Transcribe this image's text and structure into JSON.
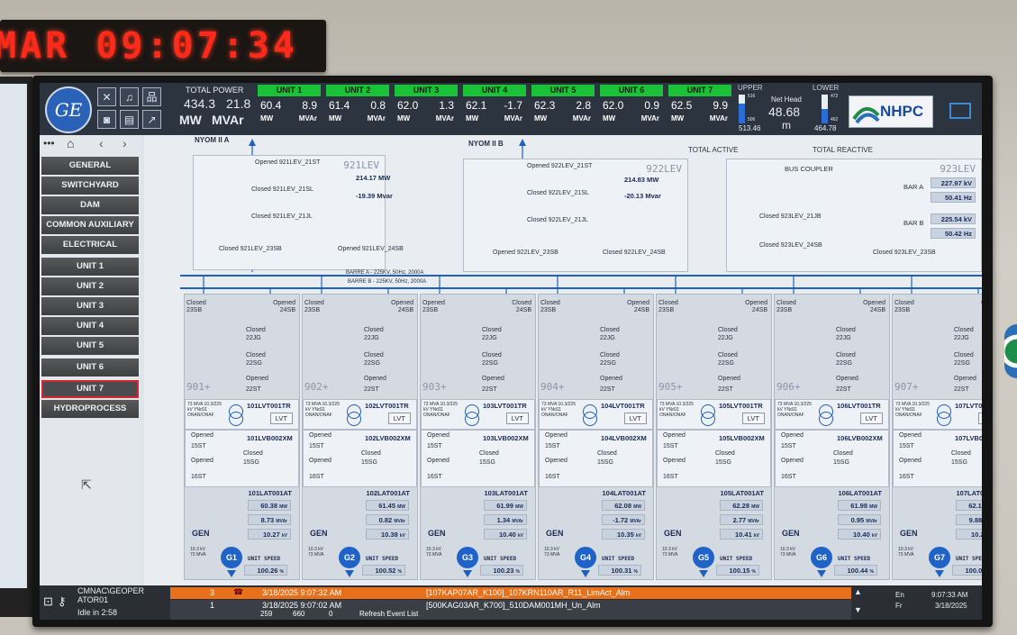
{
  "clock": {
    "text": "MAR 09:07:34"
  },
  "topbar": {
    "total_power_label": "TOTAL POWER",
    "total_mw": "434.3",
    "total_mvar": "21.8",
    "mw_label": "MW",
    "mvar_label": "MVAr",
    "units": [
      {
        "name": "UNIT 1",
        "mw": "60.4",
        "mvar": "8.9"
      },
      {
        "name": "UNIT 2",
        "mw": "61.4",
        "mvar": "0.8"
      },
      {
        "name": "UNIT 3",
        "mw": "62.0",
        "mvar": "1.3"
      },
      {
        "name": "UNIT 4",
        "mw": "62.1",
        "mvar": "-1.7"
      },
      {
        "name": "UNIT 5",
        "mw": "62.3",
        "mvar": "2.8"
      },
      {
        "name": "UNIT 6",
        "mw": "62.0",
        "mvar": "0.9"
      },
      {
        "name": "UNIT 7",
        "mw": "62.5",
        "mvar": "9.9"
      }
    ],
    "upper_label": "UPPER",
    "lower_label": "LOWER",
    "upper_level": "513.46",
    "lower_level": "464.78",
    "upper_ticks": [
      "516",
      "506"
    ],
    "lower_ticks": [
      "472",
      "462"
    ],
    "net_head_label": "Net Head",
    "net_head_value": "48.68",
    "net_head_unit": "m",
    "logo_text": "NHPC"
  },
  "sidebar": {
    "items": [
      "GENERAL",
      "SWITCHYARD",
      "DAM",
      "COMMON AUXILIARY",
      "ELECTRICAL AUXILIARY",
      "UNIT 1",
      "UNIT 2",
      "UNIT 3",
      "UNIT 4",
      "UNIT 5",
      "UNIT 6",
      "UNIT 7",
      "HYDROPROCESS"
    ],
    "selected": "UNIT 7"
  },
  "diagram": {
    "line_a": "NYOM II A",
    "line_b": "NYOM II B",
    "total_active": "TOTAL ACTIVE",
    "total_reactive": "TOTAL REACTIVE",
    "bus_coupler": "BUS COUPLER",
    "barre_a": "BARRE A - 225KV, 50Hz, 2000A",
    "barre_b": "BARRE B - 225KV, 50Hz, 2000A",
    "lev921": {
      "name": "921LEV",
      "mw": "214.17 MW",
      "mvar": "-19.39 Mvar",
      "sw": [
        "Opened 921LEV_21ST",
        "Closed 921LEV_21SL",
        "Closed 921LEV_21JL",
        "Closed 921LEV_23SB",
        "Opened 921LEV_24SB"
      ]
    },
    "lev922": {
      "name": "922LEV",
      "mw": "214.83 MW",
      "mvar": "-20.13 Mvar",
      "sw": [
        "Opened 922LEV_21ST",
        "Closed 922LEV_21SL",
        "Closed 922LEV_21JL",
        "Opened 922LEV_23SB",
        "Closed 922LEV_24SB"
      ]
    },
    "lev923": {
      "name": "923LEV",
      "bar_a": "BAR A",
      "bar_b": "BAR B",
      "a_kv": "227.97 kV",
      "a_hz": "50.41 Hz",
      "b_kv": "225.54 kV",
      "b_hz": "50.42 Hz",
      "sw": [
        "Closed 923LEV_21JB",
        "Closed 923LEV_24SB",
        "Closed 923LEV_23SB"
      ]
    },
    "bays": [
      {
        "id": "901+",
        "tr": "101LVT001TR",
        "xm": "101LVB002XM",
        "at": "101LAT001AT",
        "mw": "60.38",
        "mvar": "8.73",
        "kv": "10.27",
        "g": "G1",
        "speed": "100.26",
        "sw23": "Closed",
        "sw24": "Opened"
      },
      {
        "id": "902+",
        "tr": "102LVT001TR",
        "xm": "102LVB002XM",
        "at": "102LAT001AT",
        "mw": "61.45",
        "mvar": "0.82",
        "kv": "10.38",
        "g": "G2",
        "speed": "100.52",
        "sw23": "Closed",
        "sw24": "Opened"
      },
      {
        "id": "903+",
        "tr": "103LVT001TR",
        "xm": "103LVB002XM",
        "at": "103LAT001AT",
        "mw": "61.99",
        "mvar": "1.34",
        "kv": "10.40",
        "g": "G3",
        "speed": "100.23",
        "sw23": "Opened",
        "sw24": "Closed"
      },
      {
        "id": "904+",
        "tr": "104LVT001TR",
        "xm": "104LVB002XM",
        "at": "104LAT001AT",
        "mw": "62.08",
        "mvar": "-1.72",
        "kv": "10.35",
        "g": "G4",
        "speed": "100.31",
        "sw23": "Closed",
        "sw24": "Opened"
      },
      {
        "id": "905+",
        "tr": "105LVT001TR",
        "xm": "105LVB002XM",
        "at": "105LAT001AT",
        "mw": "62.28",
        "mvar": "2.77",
        "kv": "10.41",
        "g": "G5",
        "speed": "100.15",
        "sw23": "Closed",
        "sw24": "Opened"
      },
      {
        "id": "906+",
        "tr": "106LVT001TR",
        "xm": "106LVB002XM",
        "at": "106LAT001AT",
        "mw": "61.98",
        "mvar": "0.95",
        "kv": "10.40",
        "g": "G6",
        "speed": "100.44",
        "sw23": "Closed",
        "sw24": "Opened"
      },
      {
        "id": "907+",
        "tr": "107LVT001TR",
        "xm": "107LVB002XM",
        "at": "107LAT001AT",
        "mw": "62.13",
        "mvar": "9.88",
        "kv": "10.29",
        "g": "G7",
        "speed": "100.06",
        "sw23": "Closed",
        "sw24": "Opened"
      }
    ],
    "bay_text": {
      "jg": "22JG",
      "sg": "22SG",
      "st": "22ST",
      "sb23": "23SB",
      "sb24": "24SB",
      "closed": "Closed",
      "opened": "Opened",
      "tr_rating": "73 MVA 10.3/225 kV YNd11 ONAN/ONAF",
      "lvt": "LVT",
      "st15": "15ST",
      "sg15": "15SG",
      "st16": "16ST",
      "gen": "GEN",
      "gen_rating": "10.3 kV 73 MVA",
      "unit_speed": "UNIT SPEED",
      "mw": "MW",
      "mvar": "MVAr",
      "kv": "kV",
      "pct": "%"
    }
  },
  "bottom": {
    "user": "CMNAC\\GEOPER ATOR01",
    "idle": "Idle in 2:58",
    "alarm1": {
      "n": "3",
      "time": "3/18/2025 9:07:32 AM",
      "msg": "[107KAP07AR_K100]_107KRN110AR_R11_LimAct_Alm"
    },
    "alarm2": {
      "n": "1",
      "time": "3/18/2025 9:07:02 AM",
      "msg": "[500KAG03AR_K700]_510DAM001MH_Un_Alm"
    },
    "counts": [
      "259",
      "660",
      "0"
    ],
    "refresh": "Refresh Event List",
    "lang": [
      "En",
      "Fr"
    ],
    "time": "9:07:33 AM",
    "date": "3/18/2025"
  },
  "colors": {
    "unit_header": "#19c236",
    "topbar": "#2c3440",
    "alarm": "#e8701a",
    "generator": "#1f63c9"
  }
}
